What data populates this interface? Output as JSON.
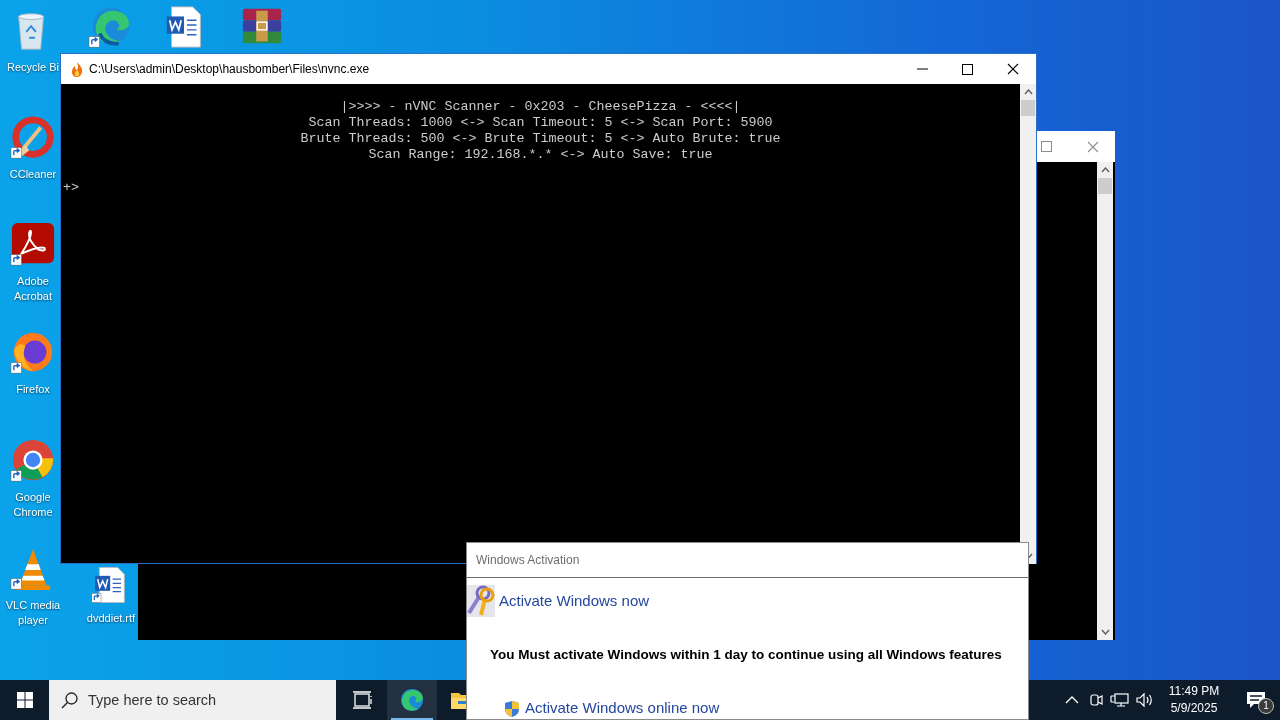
{
  "desktop_icons": [
    {
      "kind": "recycle",
      "label": "Recycle Bi"
    },
    {
      "kind": "edge"
    },
    {
      "kind": "word"
    },
    {
      "kind": "winrar"
    },
    {
      "kind": "ccleaner",
      "label": "CCleaner"
    },
    {
      "kind": "acrobat",
      "label": "Adobe Acrobat"
    },
    {
      "kind": "firefox",
      "label": "Firefox"
    },
    {
      "kind": "chrome",
      "label": "Google Chrome"
    },
    {
      "kind": "vlc",
      "label": "VLC media player"
    },
    {
      "kind": "word",
      "label": "dvddiet.rtf"
    }
  ],
  "console_window": {
    "title": "C:\\Users\\admin\\Desktop\\hausbomber\\Files\\nvnc.exe",
    "lines": [
      "|>>>> - nVNC Scanner - 0x203 - CheesePizza - <<<<|",
      "Scan Threads: 1000 <-> Scan Timeout: 5 <-> Scan Port: 5900",
      "Brute Threads: 500 <-> Brute Timeout: 5 <-> Auto Brute: true",
      "Scan Range: 192.168.*.* <-> Auto Save: true"
    ],
    "prompt": "+>"
  },
  "activation_dialog": {
    "title": "Windows Activation",
    "heading": "Activate Windows now",
    "message": "You Must activate Windows within 1 day to continue using all Windows features",
    "action": "Activate Windows online now"
  },
  "taskbar": {
    "search": {
      "placeholder": "Type here to search"
    },
    "pinned": [
      {
        "kind": "taskview",
        "selected": false
      },
      {
        "kind": "edge",
        "selected": true
      },
      {
        "kind": "explorer",
        "selected": false
      }
    ],
    "time": "11:49 PM",
    "date": "5/9/2025",
    "notification_count": "1"
  }
}
